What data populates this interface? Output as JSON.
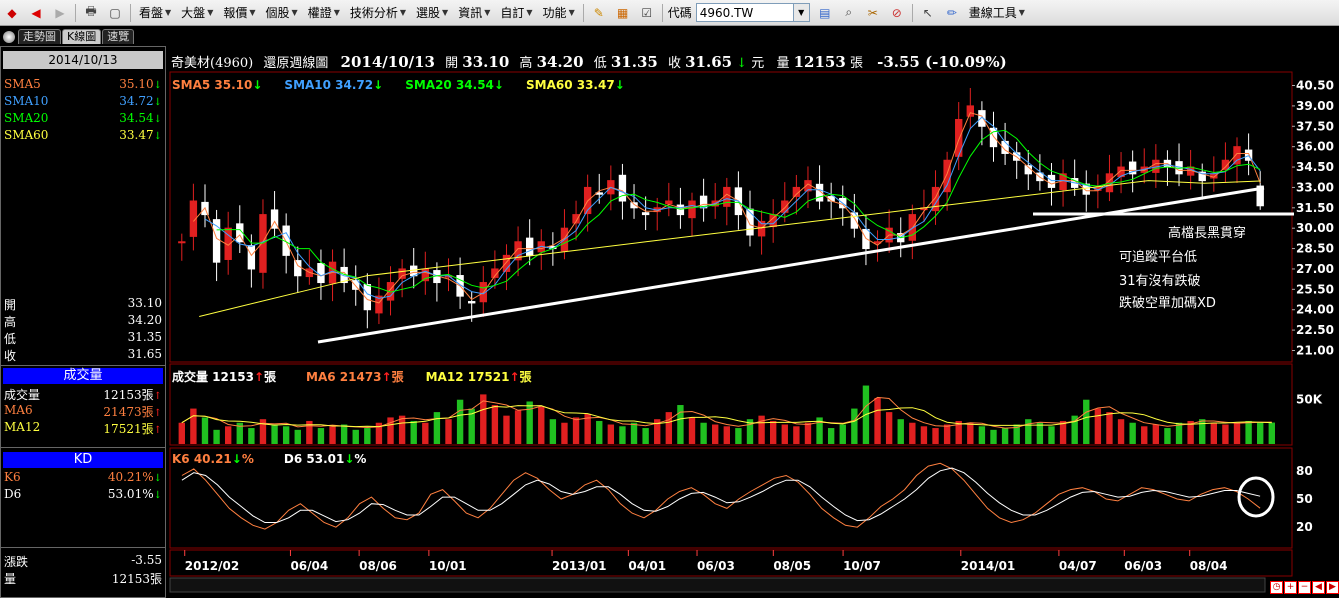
{
  "toolbar": {
    "menus": [
      "看盤",
      "大盤",
      "報價",
      "個股",
      "權證",
      "技術分析",
      "選股",
      "資訊",
      "自訂",
      "功能"
    ],
    "code_label": "代碼",
    "code_value": "4960.TW",
    "draw_tools": "畫線工具"
  },
  "tabs": [
    "走勢圖",
    "K線圖",
    "速覽"
  ],
  "left": {
    "date": "2014/10/13",
    "sma": [
      {
        "label": "SMA5",
        "value": "35.10",
        "color": "#ff8040",
        "dir": "down"
      },
      {
        "label": "SMA10",
        "value": "34.72",
        "color": "#40a0ff",
        "dir": "down"
      },
      {
        "label": "SMA20",
        "value": "34.54",
        "color": "#00ff00",
        "dir": "down"
      },
      {
        "label": "SMA60",
        "value": "33.47",
        "color": "#ffff40",
        "dir": "down"
      }
    ],
    "ohlc": [
      {
        "label": "開",
        "value": "33.10"
      },
      {
        "label": "高",
        "value": "34.20"
      },
      {
        "label": "低",
        "value": "31.35"
      },
      {
        "label": "收",
        "value": "31.65"
      }
    ],
    "volume_title": "成交量",
    "volume_rows": [
      {
        "label": "成交量",
        "value": "12153張",
        "color": "#ffffff",
        "dir": "up"
      },
      {
        "label": "MA6",
        "value": "21473張",
        "color": "#ff8040",
        "dir": "up"
      },
      {
        "label": "MA12",
        "value": "17521張",
        "color": "#ffff40",
        "dir": "up"
      }
    ],
    "kd_title": "KD",
    "kd_rows": [
      {
        "label": "K6",
        "value": "40.21%",
        "color": "#ff8040",
        "dir": "down"
      },
      {
        "label": "D6",
        "value": "53.01%",
        "color": "#ffffff",
        "dir": "down"
      }
    ],
    "change_label": "漲跌",
    "change_value": "-3.55",
    "qty_label": "量",
    "qty_value": "12153張"
  },
  "header": {
    "name": "奇美材(4960)",
    "chart_type": "還原週線圖",
    "date": "2014/10/13",
    "open_label": "開",
    "open": "33.10",
    "high_label": "高",
    "high": "34.20",
    "low_label": "低",
    "low": "31.35",
    "close_label": "收",
    "close": "31.65",
    "unit": "元",
    "vol_label": "量",
    "vol": "12153",
    "vol_unit": "張",
    "change": "-3.55 (-10.09%)"
  },
  "price_legend": [
    {
      "name": "SMA5",
      "value": "35.10",
      "color": "#ff8040"
    },
    {
      "name": "SMA10",
      "value": "34.72",
      "color": "#40a0ff"
    },
    {
      "name": "SMA20",
      "value": "34.54",
      "color": "#00ff00"
    },
    {
      "name": "SMA60",
      "value": "33.47",
      "color": "#ffff40"
    }
  ],
  "volume_legend": [
    {
      "name": "成交量",
      "value": "12153",
      "unit": "張",
      "color": "#ffffff"
    },
    {
      "name": "MA6",
      "value": "21473",
      "unit": "張",
      "color": "#ff8040"
    },
    {
      "name": "MA12",
      "value": "17521",
      "unit": "張",
      "color": "#ffff40"
    }
  ],
  "kd_legend": [
    {
      "name": "K6",
      "value": "40.21",
      "unit": "%",
      "color": "#ff8040"
    },
    {
      "name": "D6",
      "value": "53.01",
      "unit": "%",
      "color": "#ffffff"
    }
  ],
  "annotations": [
    "高檔長黑貫穿",
    "可追蹤平台低",
    "31有沒有跌破",
    "跌破空單加碼XD"
  ],
  "chart_data": [
    {
      "type": "candlestick",
      "y_ticks": [
        "40.50",
        "39.00",
        "37.50",
        "36.00",
        "34.50",
        "33.00",
        "31.50",
        "30.00",
        "28.50",
        "27.00",
        "25.50",
        "24.00",
        "22.50",
        "21.00"
      ],
      "ylim": [
        20.3,
        41.2
      ],
      "x_ticks": [
        "2012/02",
        "06/04",
        "08/06",
        "10/01",
        "2013/01",
        "04/01",
        "06/03",
        "08/05",
        "10/07",
        "2014/01",
        "04/07",
        "06/03",
        "08/04"
      ],
      "close_path": [
        29,
        32,
        31,
        27.5,
        30,
        29,
        27,
        31,
        30,
        28,
        26.5,
        27,
        26,
        27.5,
        26,
        25.5,
        24,
        25,
        26,
        27,
        26.5,
        27,
        26,
        26.5,
        25,
        24.5,
        26,
        27,
        28,
        29,
        28,
        29,
        28.5,
        30,
        31,
        33,
        32.5,
        33.5,
        32,
        31.5,
        31,
        31.5,
        32,
        31,
        32,
        31.5,
        32,
        33,
        31,
        29.5,
        30.5,
        31,
        32,
        33,
        33.5,
        32,
        32,
        31.5,
        30,
        28.5,
        29,
        30,
        29,
        31,
        31.5,
        33,
        35,
        38,
        39,
        37.5,
        36,
        35.5,
        35,
        34,
        33.5,
        33,
        34,
        33,
        32.5,
        33,
        34,
        34.5,
        34,
        34.5,
        35,
        34.5,
        34,
        34.5,
        33.5,
        34,
        35,
        36,
        35,
        31.65
      ],
      "sma60_path": [
        23.5,
        24.5,
        25.5,
        26.5,
        27,
        27.5,
        28,
        28.5,
        29,
        29.5,
        30,
        30.5,
        31,
        31.5,
        32,
        32.5,
        33,
        33.5,
        33.3,
        33.47
      ]
    },
    {
      "type": "bar",
      "name": "成交量",
      "y_ticks": [
        "50K"
      ],
      "values": [
        12,
        20,
        15,
        8,
        10,
        12,
        9,
        14,
        11,
        10,
        8,
        13,
        9,
        10,
        11,
        8,
        9,
        12,
        15,
        16,
        13,
        12,
        18,
        14,
        25,
        20,
        28,
        22,
        16,
        19,
        24,
        21,
        14,
        12,
        15,
        17,
        13,
        11,
        10,
        12,
        9,
        14,
        18,
        22,
        15,
        12,
        11,
        10,
        9,
        14,
        16,
        13,
        11,
        10,
        12,
        15,
        9,
        11,
        20,
        33,
        26,
        18,
        14,
        12,
        10,
        9,
        11,
        13,
        12,
        10,
        8,
        9,
        11,
        14,
        12,
        10,
        13,
        16,
        25,
        20,
        18,
        14,
        12,
        10,
        11,
        9,
        12,
        13,
        14,
        12,
        11,
        12,
        13,
        12,
        12.1
      ]
    },
    {
      "type": "line",
      "name": "KD",
      "y_ticks": [
        "80",
        "50",
        "20"
      ],
      "ylim": [
        0,
        100
      ],
      "series": [
        {
          "name": "K6",
          "values": [
            75,
            82,
            70,
            55,
            40,
            30,
            22,
            18,
            25,
            38,
            45,
            35,
            25,
            20,
            30,
            45,
            52,
            40,
            30,
            28,
            35,
            55,
            60,
            48,
            35,
            30,
            40,
            55,
            70,
            78,
            72,
            60,
            50,
            55,
            65,
            70,
            60,
            45,
            35,
            30,
            38,
            50,
            58,
            62,
            55,
            45,
            40,
            50,
            58,
            65,
            72,
            75,
            68,
            55,
            40,
            30,
            22,
            20,
            30,
            42,
            50,
            60,
            75,
            85,
            88,
            82,
            70,
            55,
            40,
            30,
            25,
            28,
            35,
            45,
            55,
            60,
            62,
            58,
            50,
            48,
            55,
            62,
            60,
            55,
            50,
            48,
            55,
            60,
            62,
            58,
            50,
            40.21
          ]
        },
        {
          "name": "D6",
          "values": [
            70,
            78,
            75,
            65,
            52,
            42,
            32,
            25,
            25,
            30,
            38,
            38,
            32,
            26,
            28,
            35,
            45,
            44,
            38,
            33,
            33,
            42,
            52,
            52,
            45,
            38,
            38,
            45,
            55,
            65,
            70,
            66,
            58,
            55,
            58,
            63,
            63,
            55,
            45,
            38,
            37,
            42,
            50,
            56,
            57,
            52,
            46,
            47,
            52,
            58,
            65,
            70,
            70,
            63,
            52,
            42,
            33,
            27,
            28,
            34,
            42,
            50,
            60,
            72,
            80,
            83,
            78,
            68,
            56,
            46,
            38,
            33,
            33,
            38,
            45,
            52,
            57,
            58,
            55,
            52,
            53,
            57,
            59,
            58,
            55,
            52,
            53,
            56,
            59,
            59,
            56,
            53.01
          ]
        }
      ]
    }
  ]
}
